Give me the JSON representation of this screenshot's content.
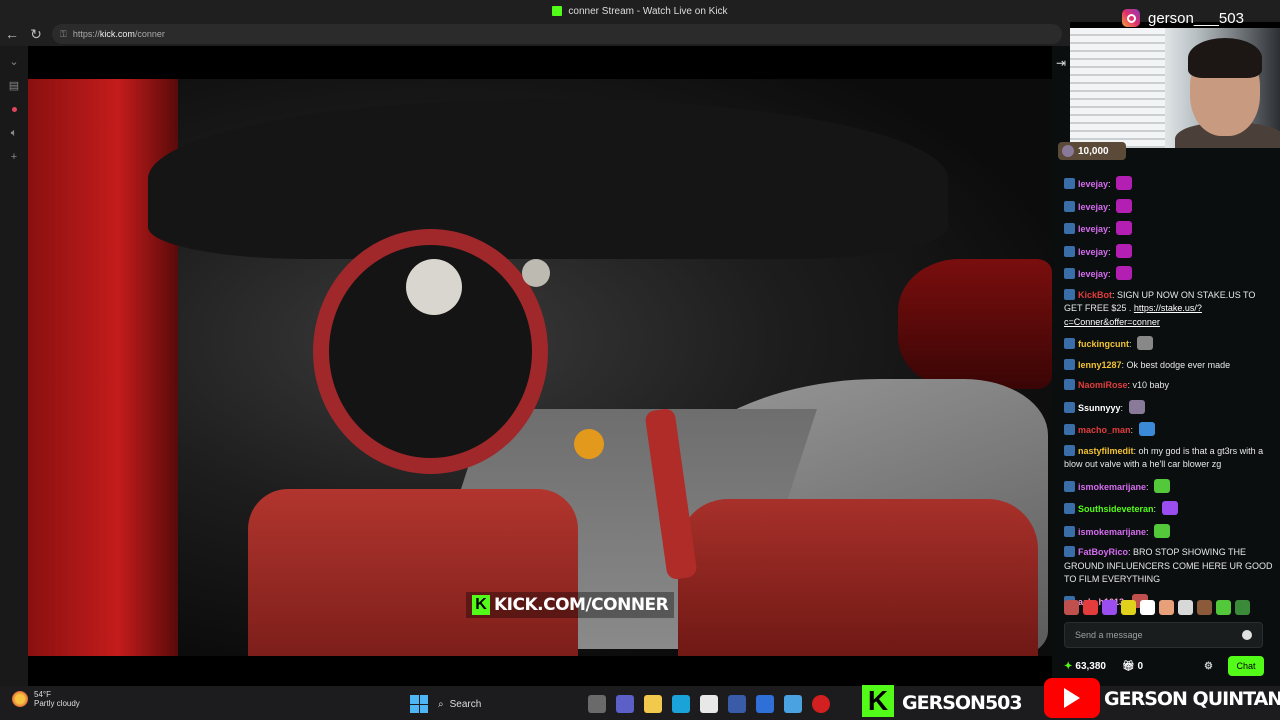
{
  "browser": {
    "tab_title": "conner Stream - Watch Live on Kick",
    "url_prefix": "https://",
    "url_domain": "kick.com",
    "url_path": "/conner"
  },
  "overlay": {
    "instagram_handle": "gerson___503",
    "banner_text": "KICK.COM/CONNER",
    "kick_handle": "GERSON503",
    "youtube_name": "GERSON QUINTANILLA"
  },
  "chat": {
    "pinned_amount": "10,000",
    "messages": [
      {
        "user": "levejay",
        "text": "",
        "color": "#d56cf0",
        "emote_color": "#b31fb3"
      },
      {
        "user": "levejay",
        "text": "",
        "color": "#d56cf0",
        "emote_color": "#b31fb3"
      },
      {
        "user": "levejay",
        "text": "",
        "color": "#d56cf0",
        "emote_color": "#b31fb3"
      },
      {
        "user": "levejay",
        "text": "",
        "color": "#d56cf0",
        "emote_color": "#b31fb3"
      },
      {
        "user": "levejay",
        "text": "",
        "color": "#d56cf0",
        "emote_color": "#b31fb3"
      },
      {
        "user": "KickBot",
        "text": "SIGN UP NOW ON STAKE.US TO GET FREE $25 .",
        "link": "https://stake.us/?c=Conner&offer=conner",
        "color": "#e23c3c"
      },
      {
        "user": "fuckingcunt",
        "text": "",
        "color": "#f1c232",
        "emote_color": "#888888"
      },
      {
        "user": "lenny1287",
        "text": "Ok best dodge ever made",
        "color": "#f1c232"
      },
      {
        "user": "NaomiRose",
        "text": "v10 baby",
        "color": "#e23c3c"
      },
      {
        "user": "Ssunnyyy",
        "text": "",
        "color": "#ffffff",
        "emote_color": "#8a7a9a"
      },
      {
        "user": "macho_man",
        "text": "",
        "color": "#e23c3c",
        "emote_color": "#3a8ad8"
      },
      {
        "user": "nastyfilmedit",
        "text": "oh my god is that a gt3rs with a blow out valve with a he'll car blower zg",
        "color": "#f1c232"
      },
      {
        "user": "ismokemarijane",
        "text": "",
        "color": "#d56cf0",
        "emote_color": "#53c83a"
      },
      {
        "user": "Southsideveteran",
        "text": "",
        "color": "#53fc18",
        "emote_color": "#9a4ef0"
      },
      {
        "user": "ismokemarijane",
        "text": "",
        "color": "#d56cf0",
        "emote_color": "#53c83a"
      },
      {
        "user": "FatBoyRico",
        "text": "BRO STOP SHOWING THE GROUND INFLUENCERS COME HERE UR GOOD TO FILM EVERYTHING",
        "color": "#d56cf0"
      },
      {
        "user": "ash_h1013",
        "text": "",
        "color": "#f1a0d8",
        "emote_color": "#c0504d"
      }
    ],
    "input_placeholder": "Send a message",
    "points": "63,380",
    "gift_count": "0",
    "chat_button": "Chat"
  },
  "taskbar": {
    "temperature": "54°F",
    "condition": "Partly cloudy",
    "search_label": "Search"
  },
  "icons": {
    "back": "back-arrow-icon",
    "reload": "reload-icon",
    "lock": "lock-icon",
    "chat_collapse": "collapse-chat-icon",
    "settings": "gear-icon"
  }
}
